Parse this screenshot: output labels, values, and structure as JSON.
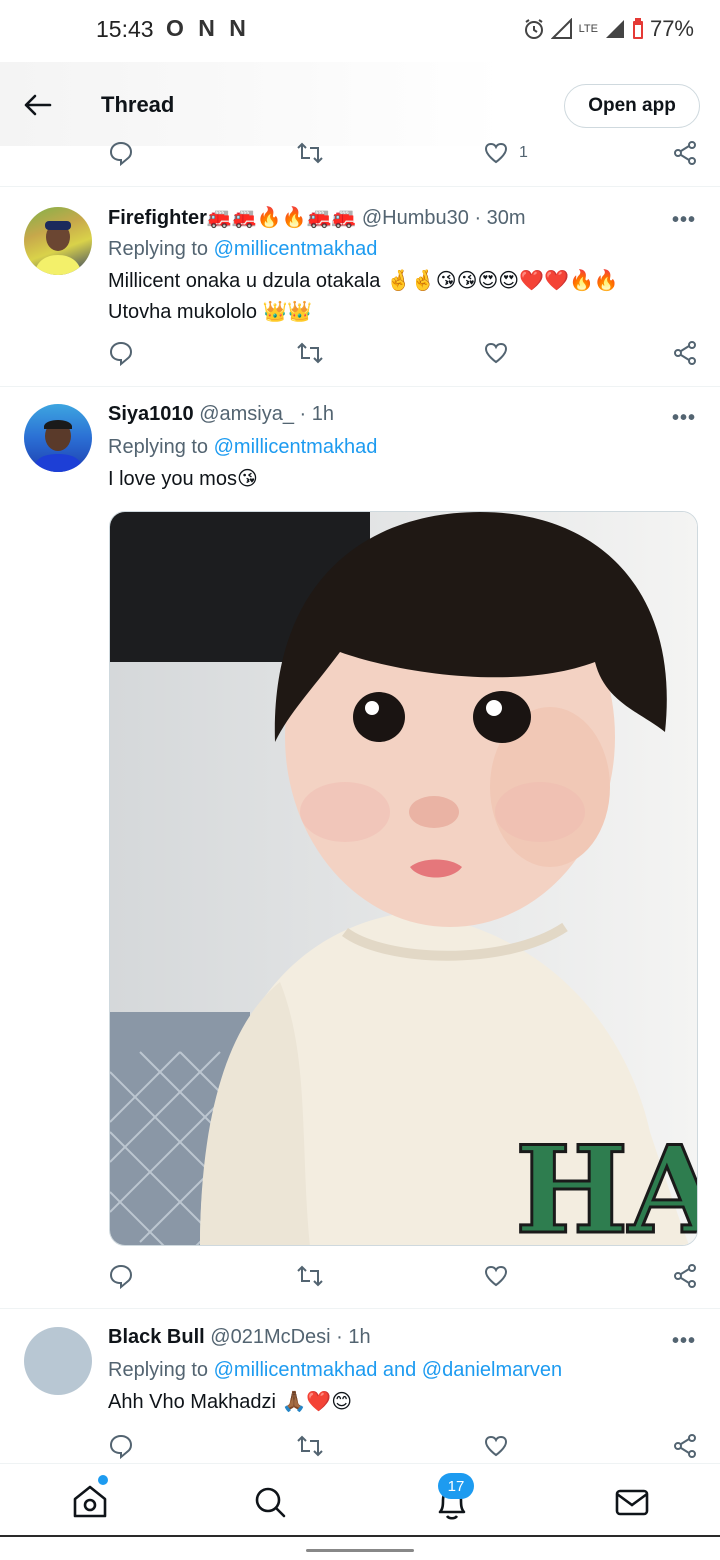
{
  "status_bar": {
    "time": "15:43",
    "app_icons": "O N N",
    "battery": "77%",
    "network": "LTE"
  },
  "header": {
    "title": "Thread",
    "open_app_label": "Open app"
  },
  "top_actions": {
    "like_count": "1"
  },
  "tweets": [
    {
      "name": "Firefighter🚒🚒🔥🔥🚒🚒",
      "handle": "@Humbu30",
      "time": "· 30m",
      "replying_prefix": "Replying to ",
      "mentions": "@millicentmakhad",
      "text_lines": [
        "Millicent onaka u dzula otakala 🤞🤞😘😘😍😍❤️❤️🔥🔥",
        "Utovha mukololo 👑👑"
      ]
    },
    {
      "name": "Siya1010",
      "handle": "@amsiya_",
      "time": "· 1h",
      "replying_prefix": "Replying to ",
      "mentions": "@millicentmakhad",
      "text_lines": [
        "I love you mos😘"
      ],
      "photo_text": "HAWAI"
    },
    {
      "name": "Black Bull",
      "handle": "@021McDesi",
      "time": "· 1h",
      "replying_prefix": "Replying to ",
      "mentions": "@millicentmakhad and @danielmarven",
      "text_lines": [
        "Ahh Vho Makhadzi 🙏🏾❤️😊"
      ]
    }
  ],
  "more_label": "•••",
  "bottom_nav": {
    "notifications_badge": "17",
    "items": [
      "home-icon",
      "search-icon",
      "bell-icon",
      "mail-icon"
    ]
  },
  "colors": {
    "accent": "#1d9bf0",
    "secondary_text": "#536471",
    "primary_text": "#0f1419"
  }
}
